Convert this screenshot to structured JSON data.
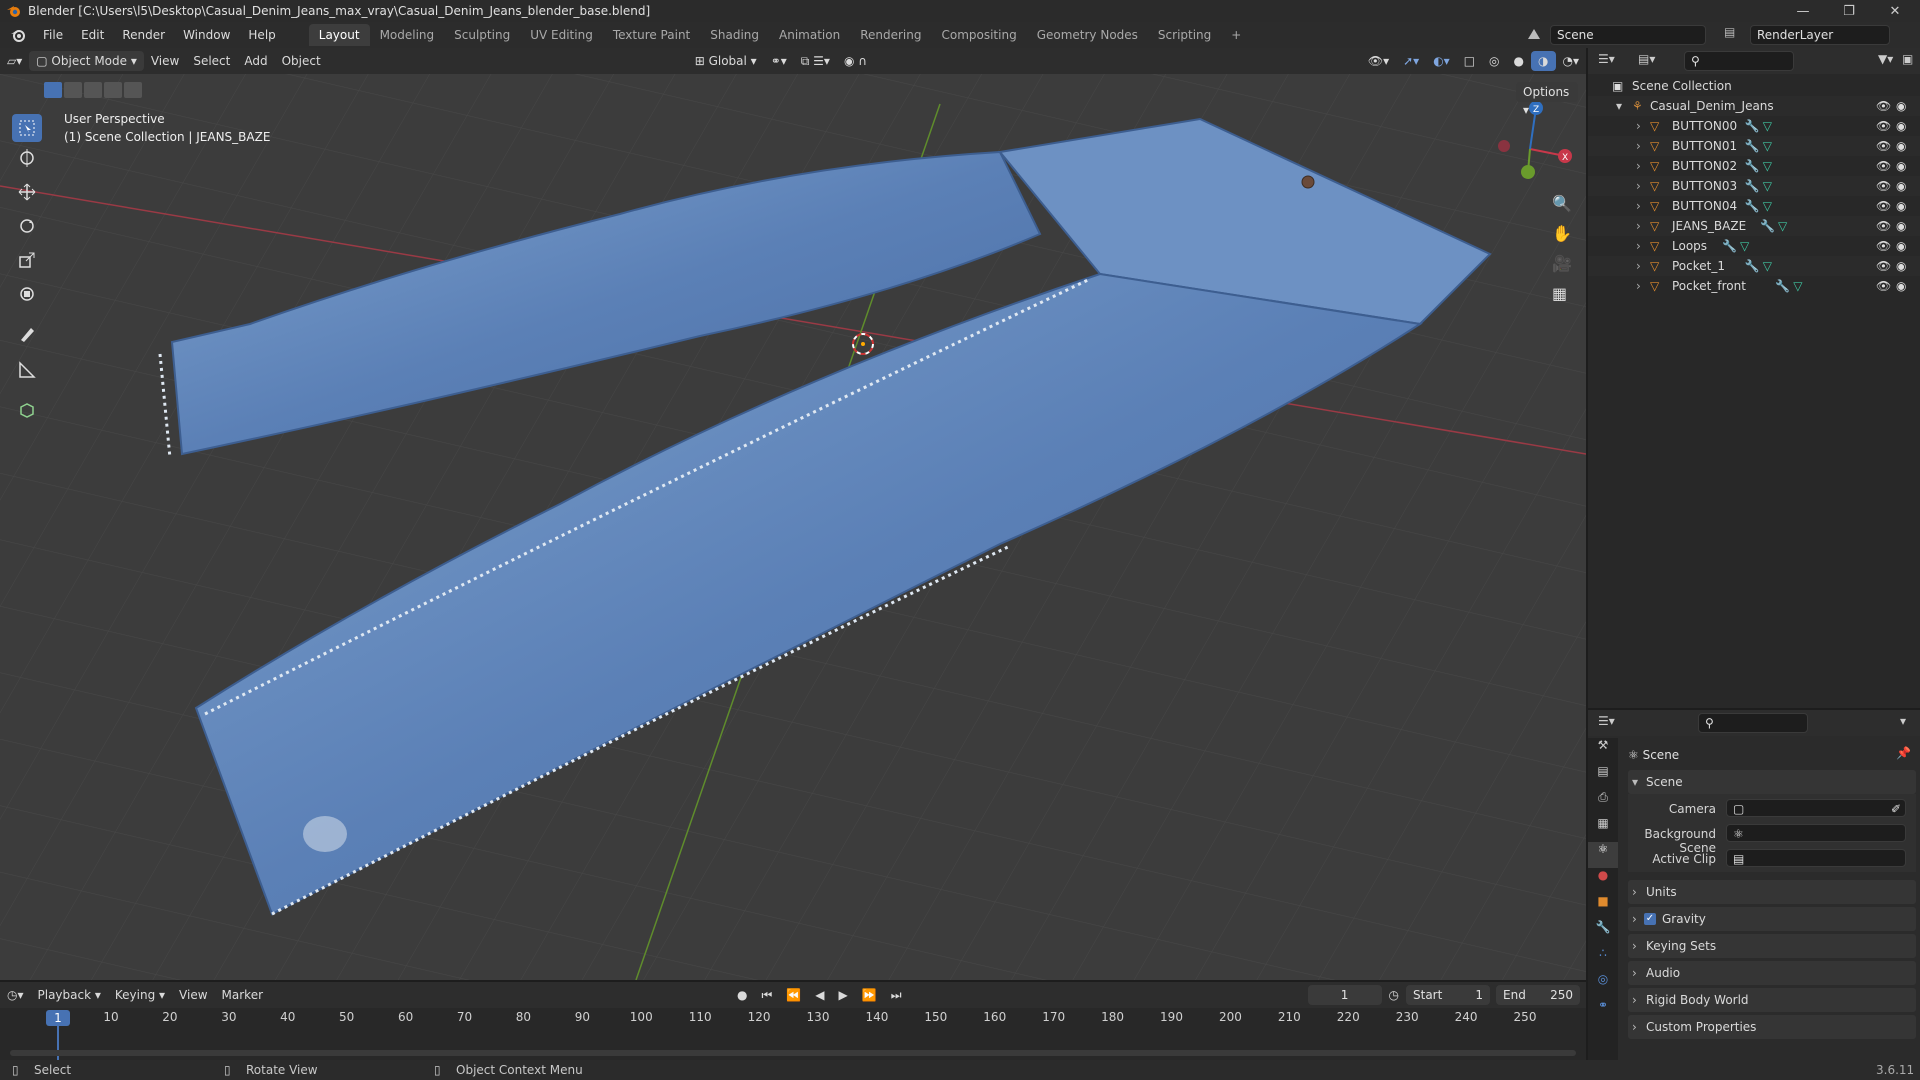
{
  "window": {
    "title": "Blender [C:\\Users\\l5\\Desktop\\Casual_Denim_Jeans_max_vray\\Casual_Denim_Jeans_blender_base.blend]"
  },
  "menus": [
    "File",
    "Edit",
    "Render",
    "Window",
    "Help"
  ],
  "workspaces": [
    "Layout",
    "Modeling",
    "Sculpting",
    "UV Editing",
    "Texture Paint",
    "Shading",
    "Animation",
    "Rendering",
    "Compositing",
    "Geometry Nodes",
    "Scripting"
  ],
  "topright": {
    "scene": "Scene",
    "view_layer": "RenderLayer"
  },
  "viewport_header": {
    "mode": "Object Mode",
    "menus": [
      "View",
      "Select",
      "Add",
      "Object"
    ],
    "transform": "Global",
    "options": "Options"
  },
  "viewport": {
    "perspective": "User Perspective",
    "collection_info": "(1) Scene Collection | JEANS_BAZE"
  },
  "outliner": {
    "root": "Scene Collection",
    "collection": "Casual_Denim_Jeans",
    "objects": [
      "BUTTON00",
      "BUTTON01",
      "BUTTON02",
      "BUTTON03",
      "BUTTON04",
      "JEANS_BAZE",
      "Loops",
      "Pocket_1",
      "Pocket_front"
    ]
  },
  "properties": {
    "context": "Scene",
    "section": "Scene",
    "fields": {
      "camera": "Camera",
      "background_scene": "Background Scene",
      "active_clip": "Active Clip"
    },
    "panels": {
      "units": "Units",
      "gravity": "Gravity",
      "keying_sets": "Keying Sets",
      "audio": "Audio",
      "rigid_body_world": "Rigid Body World",
      "custom_properties": "Custom Properties"
    },
    "gravity_checked": true
  },
  "timeline": {
    "menus": [
      "Playback",
      "Keying",
      "View",
      "Marker"
    ],
    "current_frame": "1",
    "start_label": "Start",
    "start": "1",
    "end_label": "End",
    "end": "250",
    "ticks": [
      "1",
      "10",
      "20",
      "30",
      "40",
      "50",
      "60",
      "70",
      "80",
      "90",
      "100",
      "110",
      "120",
      "130",
      "140",
      "150",
      "160",
      "170",
      "180",
      "190",
      "200",
      "210",
      "220",
      "230",
      "240",
      "250"
    ]
  },
  "statusbar": {
    "select": "Select",
    "rotate": "Rotate View",
    "context_menu": "Object Context Menu",
    "version": "3.6.11"
  },
  "colors": {
    "accent": "#4772b3",
    "x_axis": "#c8384a",
    "y_axis": "#6a9b2c",
    "z_axis": "#2f6fc0",
    "object_orange": "#e08b2e"
  }
}
